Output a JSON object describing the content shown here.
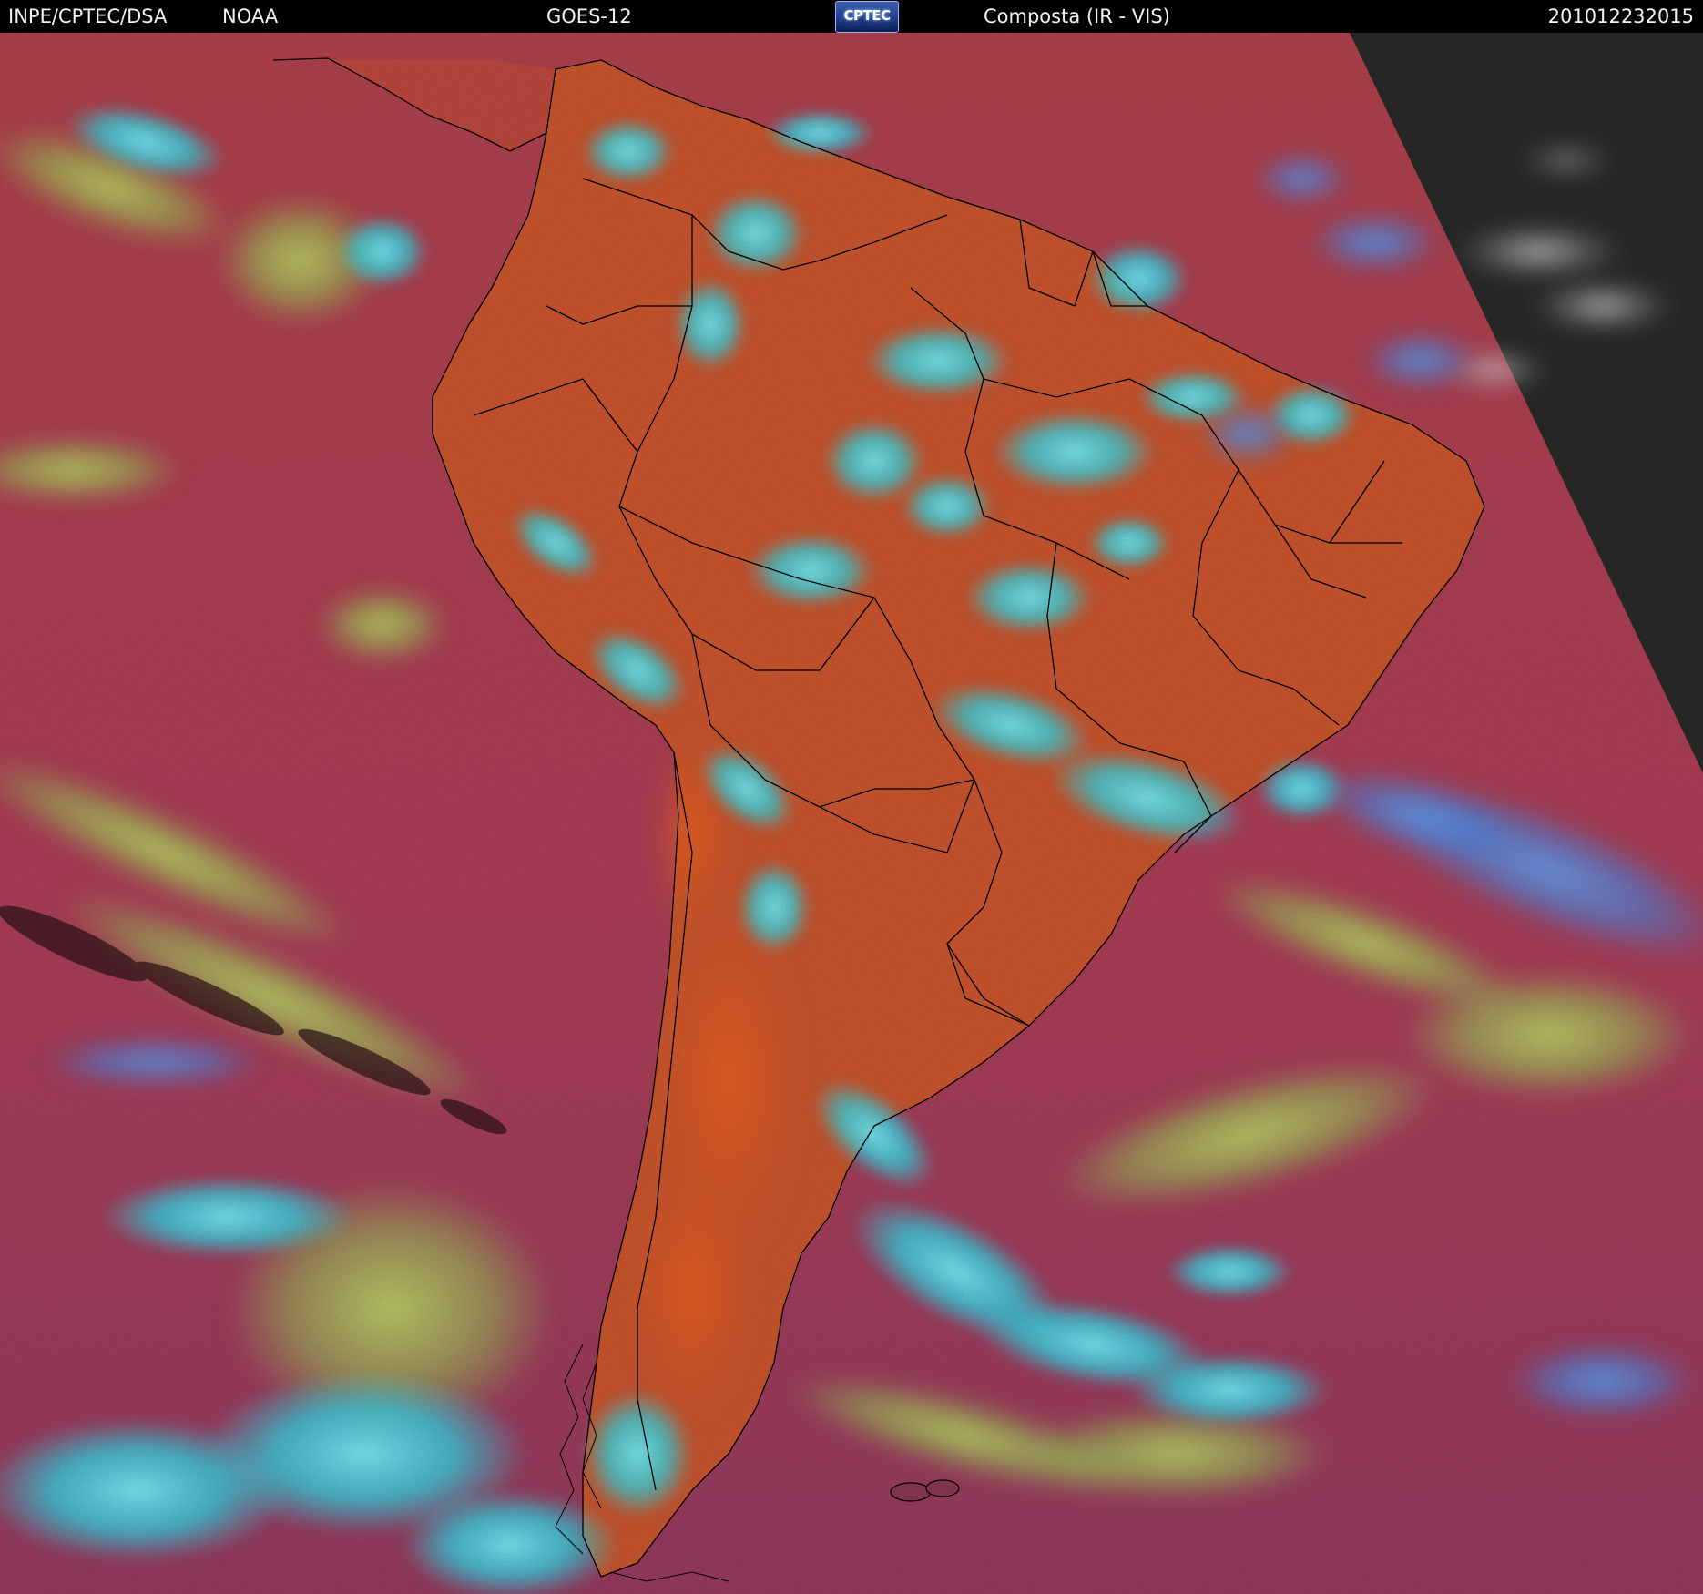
{
  "header": {
    "agency": "INPE/CPTEC/DSA",
    "source": "NOAA",
    "satellite": "GOES-12",
    "logo_text": "CPTEC",
    "product": "Composta (IR - VIS)",
    "timestamp": "201012232015"
  },
  "colors": {
    "header_background": "#000000",
    "header_text": "#f2f2f2",
    "ocean_clear": "#b8415a",
    "land_clear": "#d2572e",
    "low_cloud": "#9fd45a",
    "high_cloud": "#2fe0f0",
    "cold_cloud_top": "#4b8ce8",
    "night_side": "#2a2a2a",
    "border_lines": "#000000"
  },
  "image": {
    "type": "satellite composite",
    "region": "South America",
    "icon": "satellite-image"
  }
}
